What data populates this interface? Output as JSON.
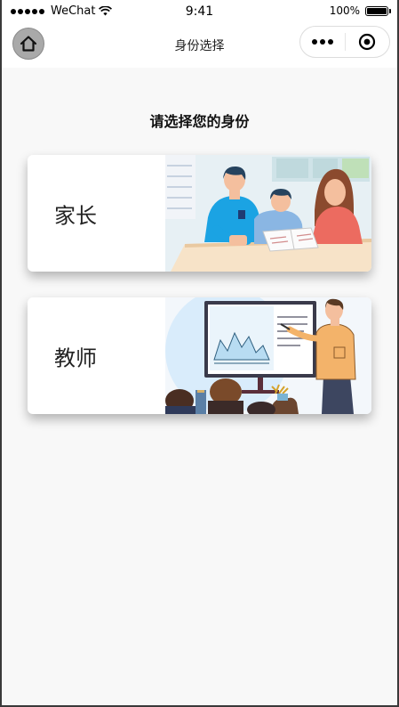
{
  "status_bar": {
    "carrier": "WeChat",
    "time": "9:41",
    "battery_percent": "100%",
    "battery_level": 1.0
  },
  "nav": {
    "title": "身份选择",
    "home_icon": "home-icon",
    "more_icon": "more-dots-icon",
    "close_icon": "record-close-icon"
  },
  "page": {
    "heading": "请选择您的身份"
  },
  "roles": [
    {
      "label": "家长",
      "illustration": "parent-child-homework-illustration"
    },
    {
      "label": "教师",
      "illustration": "teacher-presentation-illustration"
    }
  ],
  "colors": {
    "background": "#f8f8f8",
    "card": "#ffffff",
    "home_button": "#a9a9a9"
  }
}
